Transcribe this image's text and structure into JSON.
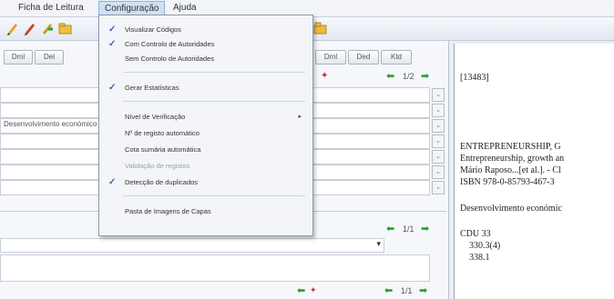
{
  "menubar": {
    "items": [
      "Ficha de Leitura",
      "Configuração",
      "Ajuda"
    ]
  },
  "tabs": [
    "Dml",
    "Del",
    "Dml",
    "Ded",
    "Ktd"
  ],
  "left_panel": {
    "field_text": "Desenvolvimento económico",
    "pager_top": "1/2",
    "pager_mid": "1/1",
    "pager_bottom": "1/1",
    "scroll_down": "v"
  },
  "dropdown": {
    "items": [
      {
        "label": "Visualizar Códigos",
        "checked": true,
        "disabled": false
      },
      {
        "label": "Com Controlo de Autoridades",
        "checked": true,
        "disabled": false
      },
      {
        "label": "Sem Controlo de Autoridades",
        "checked": false,
        "disabled": false
      },
      {
        "label": "Gerar Estatísticas",
        "checked": true,
        "disabled": false
      },
      {
        "label": "Nível de Verificação",
        "checked": false,
        "disabled": false,
        "submenu": true
      },
      {
        "label": "Nº de registo automático",
        "checked": false,
        "disabled": false
      },
      {
        "label": "Cota sumária automática",
        "checked": false,
        "disabled": false
      },
      {
        "label": "Validação de registos",
        "checked": false,
        "disabled": true
      },
      {
        "label": "Detecção de duplicados",
        "checked": true,
        "disabled": false
      },
      {
        "label": "Pasta de Imagens de Capas",
        "checked": false,
        "disabled": false
      }
    ],
    "check_glyph": "✓",
    "submenu_glyph": "▸"
  },
  "record": {
    "id": "[13483]",
    "line1": "ENTREPRENEURSHIP, G",
    "line2": "Entrepreneurship, growth an",
    "line3": "Mário Raposo...[et al.]. - Cl",
    "line4": "ISBN 978-0-85793-467-3",
    "subject": "Desenvolvimento económic",
    "cdu": "CDU 33",
    "cdu1": "330.3(4)",
    "cdu2": "338.1"
  }
}
